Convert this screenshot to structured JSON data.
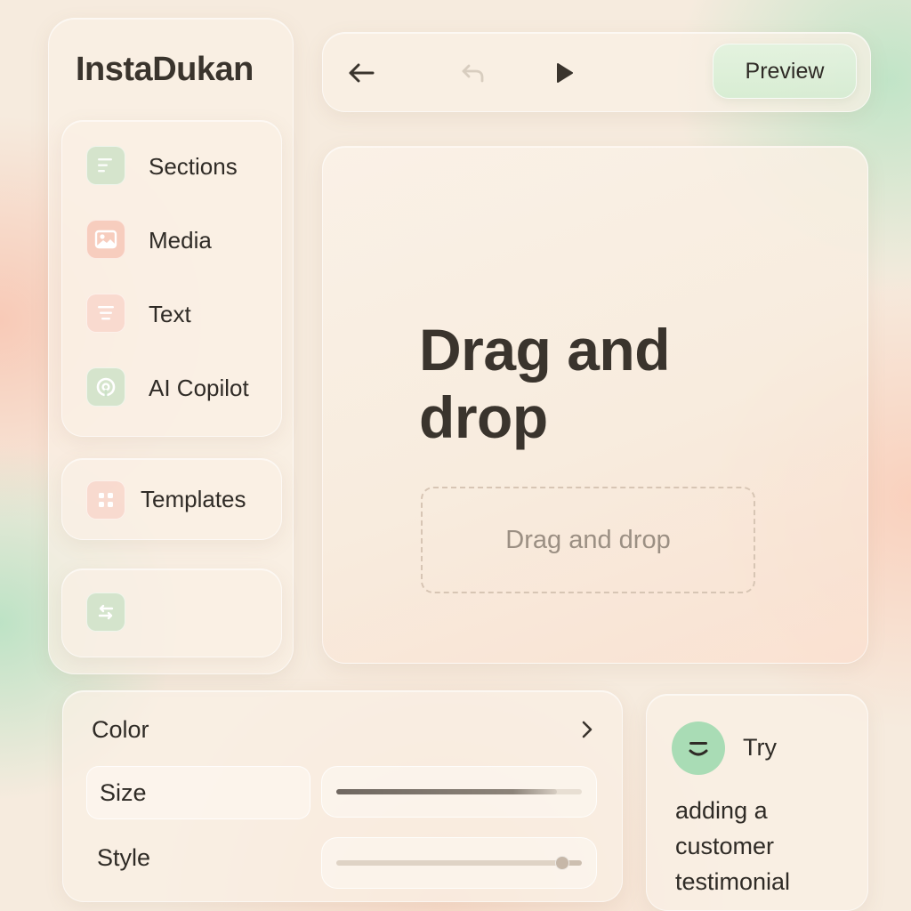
{
  "app": {
    "title": "InstaDukan"
  },
  "sidebar": {
    "items": [
      {
        "label": "Sections",
        "icon": "sections-icon"
      },
      {
        "label": "Media",
        "icon": "image-icon"
      },
      {
        "label": "Text",
        "icon": "text-icon"
      },
      {
        "label": "AI Copilot",
        "icon": "copilot-icon"
      }
    ],
    "templates": {
      "label": "Templates",
      "icon": "grid-icon"
    },
    "toggle": {
      "icon": "swap-arrows-icon"
    }
  },
  "toolbar": {
    "back_icon": "arrow-left-icon",
    "undo_icon": "undo-icon",
    "play_icon": "play-icon",
    "preview_label": "Preview"
  },
  "canvas": {
    "heading": "Drag and drop",
    "dropzone_label": "Drag and drop"
  },
  "properties": {
    "color_label": "Color",
    "size_label": "Size",
    "size_value": 0.9,
    "style_label": "Style",
    "style_value": 0.92
  },
  "tip": {
    "try_label": "Try",
    "body": "adding a customer testimonial"
  },
  "colors": {
    "background": "#f6ebde",
    "accent_green": "#a9dcb5",
    "accent_pink": "#f6c4b4",
    "text": "#2f2b26"
  }
}
